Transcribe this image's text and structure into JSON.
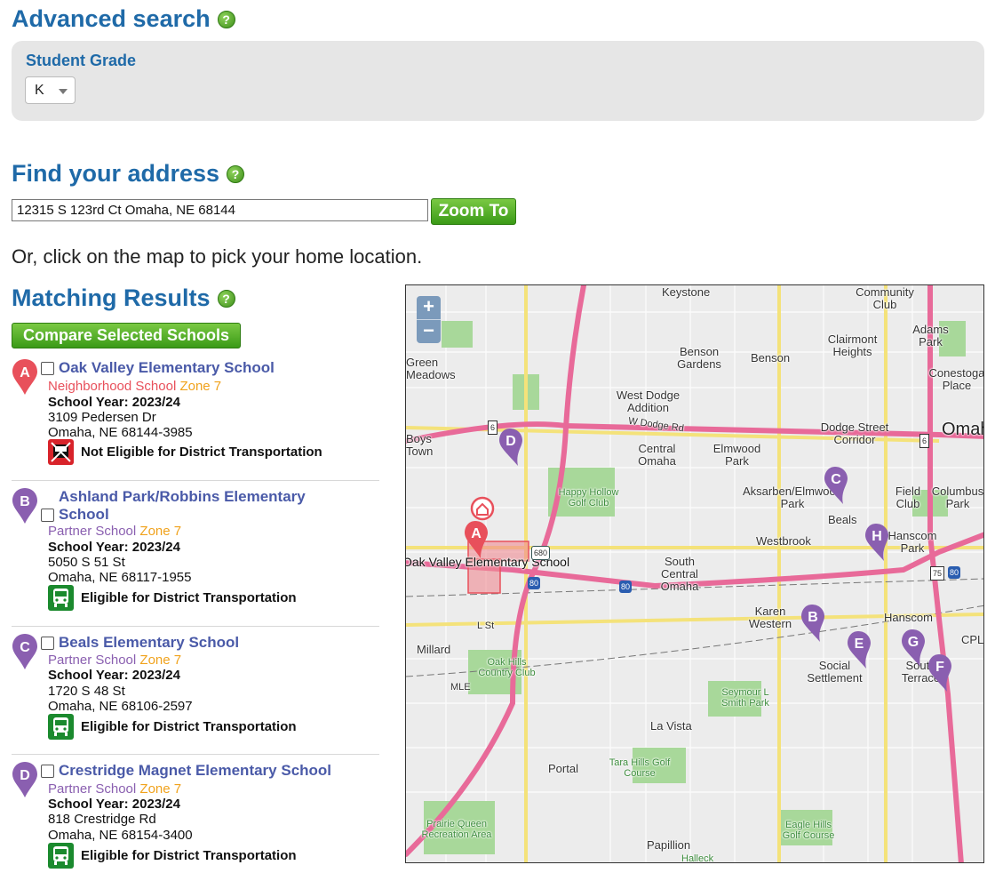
{
  "advanced_search": {
    "title": "Advanced search",
    "grade_label": "Student Grade",
    "grade_value": "K"
  },
  "find_address": {
    "title": "Find your address",
    "address_value": "12315 S 123rd Ct Omaha, NE 68144",
    "zoom_button": "Zoom To",
    "or_text": "Or, click on the map to pick your home location."
  },
  "results": {
    "title": "Matching Results",
    "compare_button": "Compare Selected Schools",
    "items": [
      {
        "letter": "A",
        "name": "Oak Valley Elementary School",
        "type": "Neighborhood School",
        "zone": "Zone 7",
        "year": "School Year: 2023/24",
        "street": "3109 Pedersen Dr",
        "city": "Omaha, NE 68144-3985",
        "transport": "Not Eligible for District Transportation"
      },
      {
        "letter": "B",
        "name_line1": "Ashland Park/Robbins Elementary",
        "name_line2": "School",
        "type": "Partner School",
        "zone": "Zone 7",
        "year": "School Year: 2023/24",
        "street": "5050 S 51 St",
        "city": "Omaha, NE 68117-1955",
        "transport": "Eligible for District Transportation"
      },
      {
        "letter": "C",
        "name": "Beals Elementary School",
        "type": "Partner School",
        "zone": "Zone 7",
        "year": "School Year: 2023/24",
        "street": "1720 S 48 St",
        "city": "Omaha, NE 68106-2597",
        "transport": "Eligible for District Transportation"
      },
      {
        "letter": "D",
        "name": "Crestridge Magnet Elementary School",
        "type": "Partner School",
        "zone": "Zone 7",
        "year": "School Year: 2023/24",
        "street": "818 Crestridge Rd",
        "city": "Omaha, NE 68154-3400",
        "transport": "Eligible for District Transportation"
      }
    ]
  },
  "map": {
    "zoom_in": "+",
    "zoom_out": "−",
    "selected_school_label": "Oak Valley Elementary School",
    "place_labels": [
      "Keystone",
      "Community Club",
      "Adams Park",
      "Benson Gardens",
      "Benson",
      "Clairmont Heights",
      "Conestoga Place",
      "Green Meadows",
      "West Dodge Addition",
      "W Dodge Rd",
      "Dodge Street Corridor",
      "Omaha",
      "Central Omaha",
      "Elmwood Park",
      "Happy Hollow Golf Club",
      "Aksarben/Elmwood Park",
      "Field Club",
      "Columbus Park",
      "Beals",
      "Westbrook",
      "Hanscom Park",
      "South Central Omaha",
      "Karen Western",
      "Hanscom",
      "CPL",
      "L St",
      "Millard",
      "Oak Hills Country Club",
      "MLE",
      "Social Settlement",
      "South Terrace",
      "Seymour L Smith Park",
      "La Vista",
      "Portal",
      "Tara Hills Golf Course",
      "Prairie Queen Recreation Area",
      "Eagle Hills Golf Course",
      "Papillion",
      "Halleck",
      "Boys Town"
    ],
    "highway_shields": [
      "680",
      "80",
      "80",
      "6",
      "6",
      "75",
      "80"
    ],
    "school_pins": [
      "A",
      "B",
      "C",
      "D",
      "E",
      "F",
      "G",
      "H"
    ],
    "colors": {
      "neighborhood_pin": "#e8505b",
      "partner_pin": "#8a5fb0",
      "highway": "#e86a99",
      "major_road": "#f4e27a",
      "park": "#a8d89a",
      "water": "#a7c8ea"
    }
  },
  "colors": {
    "heading": "#1f6aa8",
    "school_name": "#4a5aa8",
    "neighborhood_text": "#e8505b",
    "partner_text": "#8a5fb0",
    "zone_text": "#f0a21c",
    "button_green": "#4caf28"
  }
}
